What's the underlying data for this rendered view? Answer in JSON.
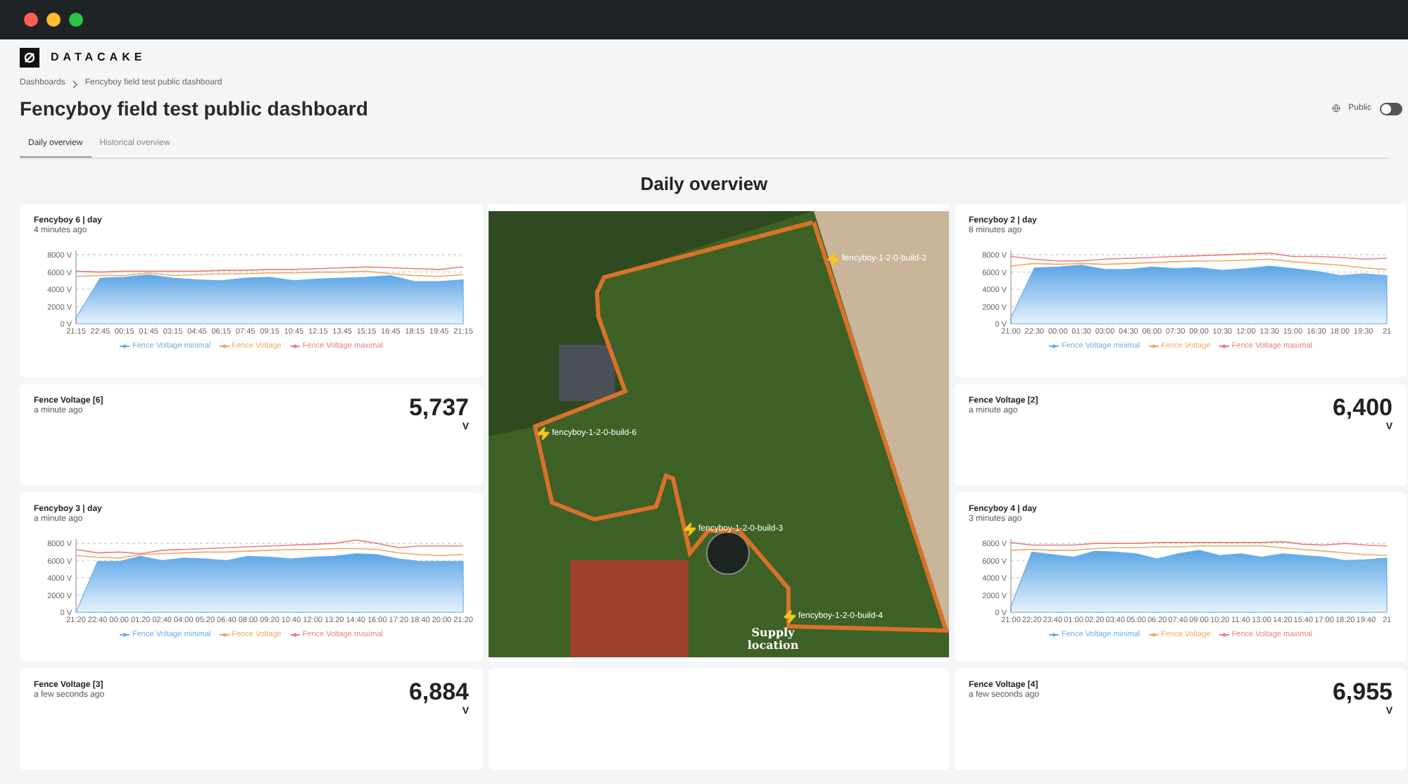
{
  "brand": {
    "name": "DATACAKE"
  },
  "breadcrumb": [
    "Dashboards",
    "Fencyboy field test public dashboard"
  ],
  "title": "Fencyboy field test public dashboard",
  "public_toggle": {
    "label": "Public",
    "on": false
  },
  "tabs": [
    {
      "label": "Daily overview",
      "selected": true
    },
    {
      "label": "Historical overview",
      "selected": false
    }
  ],
  "section_title": "Daily overview",
  "columns": [
    {
      "widgets": [
        {
          "kind": "chart",
          "title": "Fencyboy 6 | day",
          "subtitle": "4 minutes ago",
          "chart_data": {
            "type": "area",
            "categories": [
              "21:15",
              "22:45",
              "00:15",
              "01:45",
              "03:15",
              "04:45",
              "06:15",
              "07:45",
              "09:15",
              "10:45",
              "12:15",
              "13:45",
              "15:15",
              "16:45",
              "18:15",
              "19:45",
              "21:15"
            ],
            "grid": true,
            "ylim": [
              0,
              8500
            ],
            "yticks": [
              {
                "value": 0,
                "label": "0 V"
              },
              {
                "value": 2000,
                "label": "2000 V"
              },
              {
                "value": 4000,
                "label": "4000 V"
              },
              {
                "value": 6000,
                "label": "6000 V"
              },
              {
                "value": 8000,
                "label": "8000 V"
              }
            ],
            "series": [
              {
                "name": "Fence Voltage minimal",
                "type": "area",
                "color": "#6aaee8",
                "values": [
                  700,
                  5300,
                  5400,
                  5700,
                  5300,
                  5100,
                  5000,
                  5300,
                  5400,
                  5000,
                  5200,
                  5300,
                  5400,
                  5600,
                  4900,
                  4900,
                  5100
                ]
              },
              {
                "name": "Fence Voltage",
                "type": "line",
                "color": "#f0a860",
                "values": [
                  5500,
                  5600,
                  5600,
                  5900,
                  5600,
                  5700,
                  5800,
                  5800,
                  5900,
                  5900,
                  6000,
                  6000,
                  6100,
                  5800,
                  5600,
                  5500,
                  5700
                ]
              },
              {
                "name": "Fence Voltage maximal",
                "type": "line",
                "color": "#e88080",
                "values": [
                  6100,
                  6000,
                  6100,
                  6100,
                  6100,
                  6100,
                  6200,
                  6200,
                  6300,
                  6300,
                  6400,
                  6500,
                  6600,
                  6500,
                  6400,
                  6300,
                  6600
                ]
              }
            ]
          }
        },
        {
          "kind": "kpi",
          "title": "Fence Voltage [6]",
          "subtitle": "a minute ago",
          "value": "5,737",
          "unit": "V"
        },
        {
          "kind": "chart",
          "title": "Fencyboy 3 | day",
          "subtitle": "a minute ago",
          "chart_data": {
            "type": "area",
            "categories": [
              "21:20",
              "22:40",
              "00:00",
              "01:20",
              "02:40",
              "04:00",
              "05:20",
              "06:40",
              "08:00",
              "09:20",
              "10:40",
              "12:00",
              "13:20",
              "14:40",
              "16:00",
              "17:20",
              "18:40",
              "20:00",
              "21:20"
            ],
            "grid": true,
            "ylim": [
              0,
              8500
            ],
            "yticks": [
              {
                "value": 0,
                "label": "0 V"
              },
              {
                "value": 2000,
                "label": "2000 V"
              },
              {
                "value": 4000,
                "label": "4000 V"
              },
              {
                "value": 6000,
                "label": "6000 V"
              },
              {
                "value": 8000,
                "label": "8000 V"
              }
            ],
            "series": [
              {
                "name": "Fence Voltage minimal",
                "type": "area",
                "color": "#6aaee8",
                "values": [
                  0,
                  5900,
                  5900,
                  6500,
                  6000,
                  6300,
                  6200,
                  6000,
                  6500,
                  6400,
                  6200,
                  6400,
                  6500,
                  6800,
                  6700,
                  6200,
                  5900,
                  5900,
                  5900
                ]
              },
              {
                "name": "Fence Voltage",
                "type": "line",
                "color": "#f0a860",
                "values": [
                  6600,
                  6400,
                  6300,
                  6700,
                  6800,
                  6900,
                  7000,
                  7000,
                  7100,
                  7200,
                  7300,
                  7300,
                  7400,
                  7400,
                  7300,
                  6900,
                  6700,
                  6600,
                  6700
                ]
              },
              {
                "name": "Fence Voltage maximal",
                "type": "line",
                "color": "#e88080",
                "values": [
                  7300,
                  6900,
                  7000,
                  6800,
                  7200,
                  7300,
                  7400,
                  7500,
                  7600,
                  7700,
                  7800,
                  7900,
                  8000,
                  8400,
                  8000,
                  7500,
                  7700,
                  7700,
                  7700
                ]
              }
            ]
          }
        },
        {
          "kind": "kpi",
          "title": "Fence Voltage [3]",
          "subtitle": "a few seconds ago",
          "value": "6,884",
          "unit": "V"
        }
      ]
    },
    {
      "widgets": [
        {
          "kind": "map",
          "pins": [
            {
              "label": "fencyboy-1-2-0-build-2"
            },
            {
              "label": "fencyboy-1-2-0-build-6"
            },
            {
              "label": "fencyboy-1-2-0-build-3"
            },
            {
              "label": "fencyboy-1-2-0-build-4"
            }
          ],
          "map_label": "Supply location"
        },
        {
          "kind": "empty"
        }
      ]
    },
    {
      "widgets": [
        {
          "kind": "chart",
          "title": "Fencyboy 2 | day",
          "subtitle": "8 minutes ago",
          "chart_data": {
            "type": "area",
            "categories": [
              "21:00",
              "22:30",
              "00:00",
              "01:30",
              "03:00",
              "04:30",
              "06:00",
              "07:30",
              "09:00",
              "10:30",
              "12:00",
              "13:30",
              "15:00",
              "16:30",
              "18:00",
              "19:30",
              "21"
            ],
            "grid": true,
            "ylim": [
              0,
              8500
            ],
            "yticks": [
              {
                "value": 0,
                "label": "0 V"
              },
              {
                "value": 2000,
                "label": "2000 V"
              },
              {
                "value": 4000,
                "label": "4000 V"
              },
              {
                "value": 6000,
                "label": "6000 V"
              },
              {
                "value": 8000,
                "label": "8000 V"
              }
            ],
            "series": [
              {
                "name": "Fence Voltage minimal",
                "type": "area",
                "color": "#6aaee8",
                "values": [
                  700,
                  6500,
                  6600,
                  6800,
                  6300,
                  6300,
                  6600,
                  6400,
                  6500,
                  6200,
                  6400,
                  6700,
                  6400,
                  6100,
                  5600,
                  5800,
                  5600
                ]
              },
              {
                "name": "Fence Voltage",
                "type": "line",
                "color": "#f0a860",
                "values": [
                  6700,
                  7000,
                  6900,
                  7000,
                  6900,
                  7000,
                  7100,
                  7200,
                  7300,
                  7300,
                  7400,
                  7500,
                  7200,
                  7000,
                  6800,
                  6500,
                  6300
                ]
              },
              {
                "name": "Fence Voltage maximal",
                "type": "line",
                "color": "#e88080",
                "values": [
                  7800,
                  7500,
                  7300,
                  7300,
                  7500,
                  7600,
                  7700,
                  7800,
                  7900,
                  8000,
                  8100,
                  8200,
                  7800,
                  7800,
                  7700,
                  7500,
                  7600
                ]
              }
            ]
          }
        },
        {
          "kind": "kpi",
          "title": "Fence Voltage [2]",
          "subtitle": "a minute ago",
          "value": "6,400",
          "unit": "V"
        },
        {
          "kind": "chart",
          "title": "Fencyboy 4 | day",
          "subtitle": "3 minutes ago",
          "chart_data": {
            "type": "area",
            "categories": [
              "21:00",
              "22:20",
              "23:40",
              "01:00",
              "02:20",
              "03:40",
              "05:00",
              "06:20",
              "07:40",
              "09:00",
              "10:20",
              "11:40",
              "13:00",
              "14:20",
              "15:40",
              "17:00",
              "18:20",
              "19:40",
              "21"
            ],
            "grid": true,
            "ylim": [
              0,
              8500
            ],
            "yticks": [
              {
                "value": 0,
                "label": "0 V"
              },
              {
                "value": 2000,
                "label": "2000 V"
              },
              {
                "value": 4000,
                "label": "4000 V"
              },
              {
                "value": 6000,
                "label": "6000 V"
              },
              {
                "value": 8000,
                "label": "8000 V"
              }
            ],
            "series": [
              {
                "name": "Fence Voltage minimal",
                "type": "area",
                "color": "#6aaee8",
                "values": [
                  700,
                  7000,
                  6700,
                  6400,
                  7100,
                  7000,
                  6800,
                  6200,
                  6800,
                  7200,
                  6600,
                  6800,
                  6400,
                  6800,
                  6600,
                  6400,
                  6000,
                  6100,
                  6300
                ]
              },
              {
                "name": "Fence Voltage",
                "type": "line",
                "color": "#f0a860",
                "values": [
                  7200,
                  7300,
                  7200,
                  7200,
                  7400,
                  7500,
                  7500,
                  7600,
                  7600,
                  7700,
                  7700,
                  7700,
                  7700,
                  7500,
                  7300,
                  7100,
                  6900,
                  6700,
                  6600
                ]
              },
              {
                "name": "Fence Voltage maximal",
                "type": "line",
                "color": "#e88080",
                "values": [
                  8100,
                  7800,
                  7800,
                  7800,
                  8000,
                  8000,
                  8000,
                  8100,
                  8100,
                  8100,
                  8100,
                  8100,
                  8100,
                  8200,
                  7900,
                  7800,
                  8000,
                  7800,
                  7700
                ]
              }
            ]
          }
        },
        {
          "kind": "kpi",
          "title": "Fence Voltage [4]",
          "subtitle": "a few seconds ago",
          "value": "6,955",
          "unit": "V"
        }
      ]
    }
  ]
}
